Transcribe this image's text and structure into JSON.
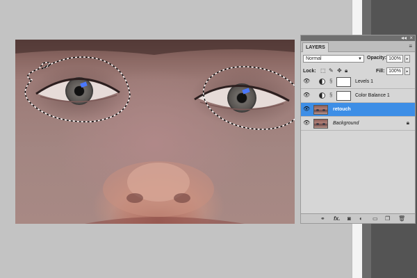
{
  "panel": {
    "tab_label": "LAYERS",
    "collapse_glyph": "◂◂",
    "close_glyph": "×",
    "menu_glyph": "≡",
    "blend_mode": "Normal",
    "opacity_label": "Opacity:",
    "opacity_value": "100%",
    "lock_label": "Lock:",
    "fill_label": "Fill:",
    "fill_value": "100%",
    "lock_icons": [
      "transparency-lock-icon",
      "brush-lock-icon",
      "move-lock-icon",
      "padlock-icon"
    ],
    "layers": [
      {
        "name": "Levels 1",
        "type": "adjustment",
        "visible": true,
        "selected": false
      },
      {
        "name": "Color Balance 1",
        "type": "adjustment",
        "visible": true,
        "selected": false
      },
      {
        "name": "retouch",
        "type": "pixel",
        "visible": true,
        "selected": true
      },
      {
        "name": "Background",
        "type": "pixel",
        "visible": true,
        "selected": false,
        "locked": true
      }
    ],
    "footer_icons": [
      "link-layers-icon",
      "fx-icon",
      "add-mask-icon",
      "adjustment-layer-icon",
      "new-group-icon",
      "new-layer-icon",
      "delete-icon"
    ],
    "footer_fx": "fx.",
    "colors": {
      "selected_row": "#3d8ee6",
      "panel_bg": "#d6d6d6"
    }
  }
}
